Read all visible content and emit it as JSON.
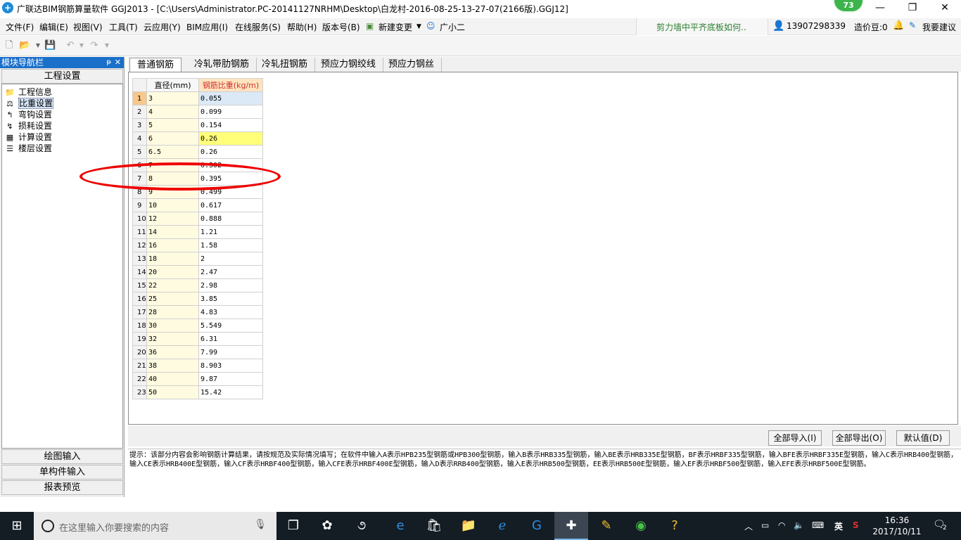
{
  "window": {
    "title": "广联达BIM钢筋算量软件 GGJ2013 - [C:\\Users\\Administrator.PC-20141127NRHM\\Desktop\\白龙村-2016-08-25-13-27-07(2166版).GGJ12]",
    "score_badge": "73",
    "minimize": "—",
    "restore": "❐",
    "close": "✕"
  },
  "menubar": {
    "items": [
      "文件(F)",
      "编辑(E)",
      "视图(V)",
      "工具(T)",
      "云应用(Y)",
      "BIM应用(I)",
      "在线服务(S)",
      "帮助(H)",
      "版本号(B)",
      "新建变更",
      "广小二"
    ],
    "qa_text": "剪力墙中平齐底板如何..",
    "phone": "13907298339",
    "price_beans": "造价豆:0",
    "suggest": "我要建议"
  },
  "sidebar": {
    "header": "模块导航栏",
    "pin": "ᵽ",
    "close": "✕",
    "top_section": "工程设置",
    "tree": [
      {
        "label": "工程信息",
        "icon": "project-info-icon",
        "glyph": "📁"
      },
      {
        "label": "比重设置",
        "icon": "weight-settings-icon",
        "glyph": "⚖"
      },
      {
        "label": "弯钩设置",
        "icon": "hook-settings-icon",
        "glyph": "↰"
      },
      {
        "label": "损耗设置",
        "icon": "loss-settings-icon",
        "glyph": "↯"
      },
      {
        "label": "计算设置",
        "icon": "calc-settings-icon",
        "glyph": "▦"
      },
      {
        "label": "楼层设置",
        "icon": "floor-settings-icon",
        "glyph": "☰"
      }
    ],
    "selected_index": 1,
    "bottom_sections": [
      "绘图输入",
      "单构件输入",
      "报表预览"
    ]
  },
  "tabs": [
    "普通钢筋",
    "冷轧带肋钢筋",
    "冷轧扭钢筋",
    "预应力钢绞线",
    "预应力钢丝"
  ],
  "active_tab": 0,
  "grid": {
    "headers": [
      "直径(mm)",
      "钢筋比重(kg/m)"
    ],
    "rows": [
      [
        "1",
        "3",
        "0.055"
      ],
      [
        "2",
        "4",
        "0.099"
      ],
      [
        "3",
        "5",
        "0.154"
      ],
      [
        "4",
        "6",
        "0.26"
      ],
      [
        "5",
        "6.5",
        "0.26"
      ],
      [
        "6",
        "7",
        "0.302"
      ],
      [
        "7",
        "8",
        "0.395"
      ],
      [
        "8",
        "9",
        "0.499"
      ],
      [
        "9",
        "10",
        "0.617"
      ],
      [
        "10",
        "12",
        "0.888"
      ],
      [
        "11",
        "14",
        "1.21"
      ],
      [
        "12",
        "16",
        "1.58"
      ],
      [
        "13",
        "18",
        "2"
      ],
      [
        "14",
        "20",
        "2.47"
      ],
      [
        "15",
        "22",
        "2.98"
      ],
      [
        "16",
        "25",
        "3.85"
      ],
      [
        "17",
        "28",
        "4.83"
      ],
      [
        "18",
        "30",
        "5.549"
      ],
      [
        "19",
        "32",
        "6.31"
      ],
      [
        "20",
        "36",
        "7.99"
      ],
      [
        "21",
        "38",
        "8.903"
      ],
      [
        "22",
        "40",
        "9.87"
      ],
      [
        "23",
        "50",
        "15.42"
      ]
    ],
    "highlight_row": 6,
    "yellow_row": 3
  },
  "buttons": {
    "import_all": "全部导入(I)",
    "export_all": "全部导出(O)",
    "default": "默认值(D)"
  },
  "hint": "提示：该部分内容会影响钢筋计算结果，请按规范及实际情况填写；在软件中输入A表示HPB235型钢筋或HPB300型钢筋，输入B表示HRB335型钢筋，输入BE表示HRB335E型钢筋，BF表示HRBF335型钢筋，输入BFE表示HRBF335E型钢筋，输入C表示HRB400型钢筋，输入CE表示HRB400E型钢筋，输入CF表示HRBF400型钢筋，输入CFE表示HRBF400E型钢筋，输入D表示RRB400型钢筋，输入E表示HRB500型钢筋，EE表示HRB500E型钢筋，输入EF表示HRBF500型钢筋，输入EFE表示HRBF500E型钢筋。",
  "taskbar": {
    "search_placeholder": "在这里输入你要搜索的内容",
    "ime": "英",
    "time": "16:36",
    "date": "2017/10/11",
    "notifications": "2"
  },
  "colors": {
    "accent": "#1a6fc9",
    "highlight_oval": "#e00000",
    "yellow_cell": "#ffff7a",
    "header_orange": "#ffe4c0"
  }
}
